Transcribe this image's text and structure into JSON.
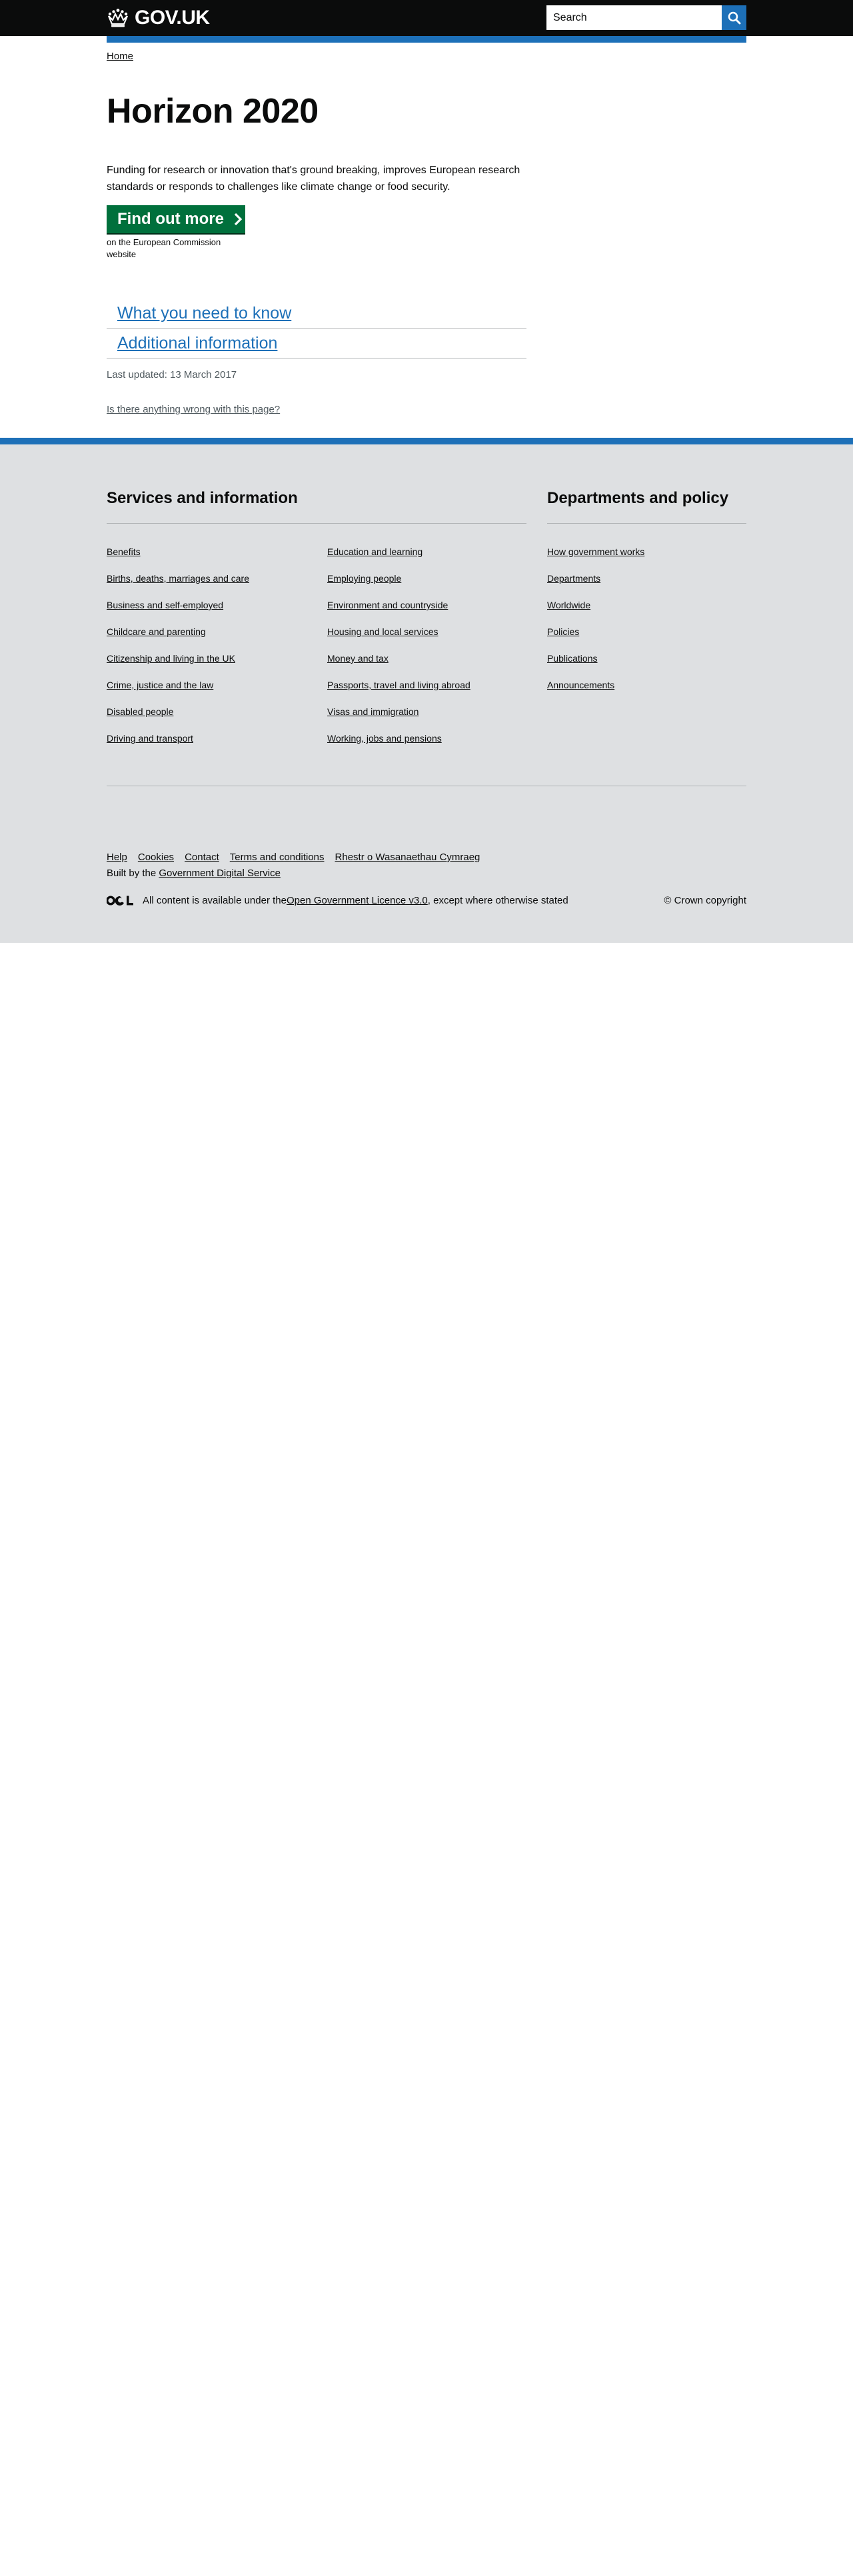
{
  "header": {
    "logo_text": "GOV.UK",
    "search_placeholder": "Search",
    "search_button_label": "Search GOV.UK"
  },
  "breadcrumb": {
    "home": "Home"
  },
  "main": {
    "title": "Horizon 2020",
    "lead": "Funding for research or innovation that's ground breaking, improves European research standards or responds to challenges like climate change or food security.",
    "cta_label": "Find out more",
    "cta_note": "on the European Commission website",
    "contents": [
      {
        "label": "What you need to know"
      },
      {
        "label": "Additional information"
      }
    ],
    "last_updated": "Last updated: 13 March 2017",
    "report_link": "Is there anything wrong with this page?"
  },
  "footer": {
    "services_heading": "Services and information",
    "services_col1": [
      "Benefits",
      "Births, deaths, marriages and care",
      "Business and self-employed",
      "Childcare and parenting",
      "Citizenship and living in the UK",
      "Crime, justice and the law",
      "Disabled people",
      "Driving and transport"
    ],
    "services_col2": [
      "Education and learning",
      "Employing people",
      "Environment and countryside",
      "Housing and local services",
      "Money and tax",
      "Passports, travel and living abroad",
      "Visas and immigration",
      "Working, jobs and pensions"
    ],
    "departments_heading": "Departments and policy",
    "departments": [
      "How government works",
      "Departments",
      "Worldwide",
      "Policies",
      "Publications",
      "Announcements"
    ],
    "meta_links": [
      "Help",
      "Cookies",
      "Contact",
      "Terms and conditions",
      "Rhestr o Wasanaethau Cymraeg"
    ],
    "built_by_prefix": "Built by the ",
    "built_by_link": "Government Digital Service",
    "licence_prefix": "All content is available under the ",
    "licence_link": "Open Government Licence v3.0",
    "licence_suffix": ", except where otherwise stated",
    "copyright": "© Crown copyright"
  },
  "colors": {
    "header_bg": "#0b0c0c",
    "brand_blue": "#1d70b8",
    "button_green": "#00703c",
    "footer_bg": "#dee0e2"
  },
  "icons": [
    "crown-icon",
    "search-icon",
    "chevron-right-icon",
    "ogl-icon"
  ]
}
